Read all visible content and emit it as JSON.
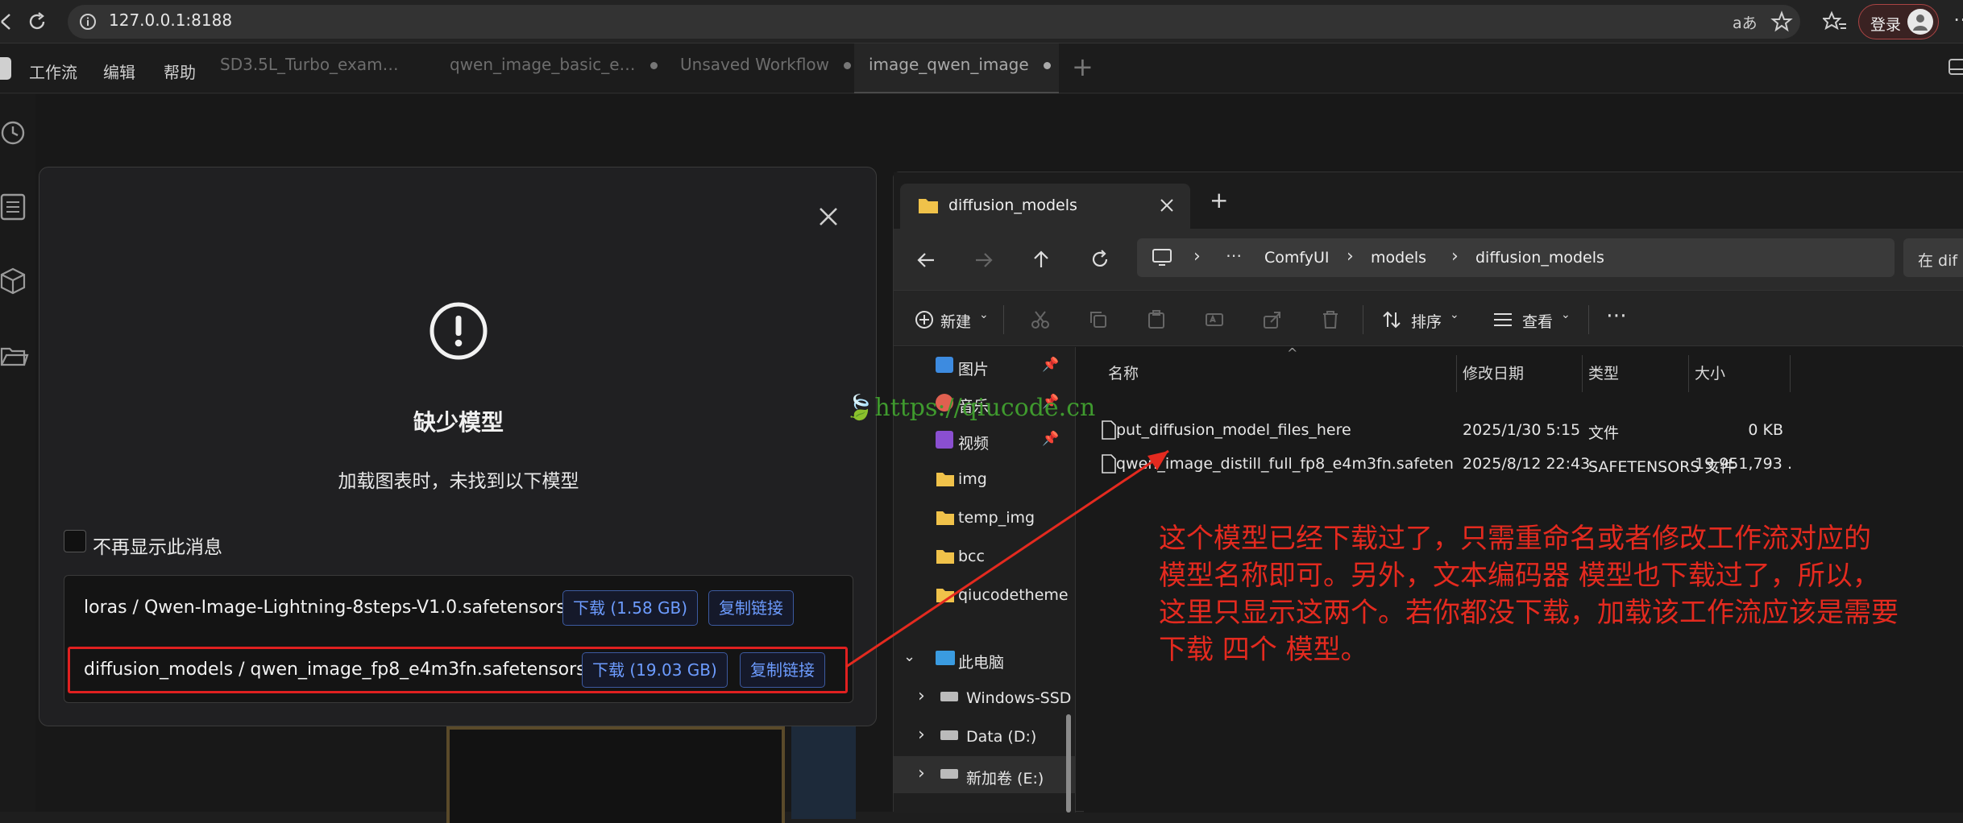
{
  "browser": {
    "url": "127.0.0.1:8188",
    "translate_glyph": "aあ",
    "login_label": "登录"
  },
  "comfy": {
    "menus": [
      "工作流",
      "编辑",
      "帮助"
    ],
    "tabs": [
      {
        "label": "SD3.5L_Turbo_exam…",
        "dot": false
      },
      {
        "label": "qwen_image_basic_e…",
        "dot": true
      },
      {
        "label": "Unsaved Workflow",
        "dot": true
      },
      {
        "label": "image_qwen_image",
        "dot": true
      }
    ],
    "sidebar_icons": [
      "history-icon",
      "document-icon",
      "cube-icon",
      "folder-icon"
    ]
  },
  "dialog": {
    "title": "缺少模型",
    "subtitle": "加载图表时，未找到以下模型",
    "checkbox_label": "不再显示此消息",
    "models": [
      {
        "name": "loras / Qwen-Image-Lightning-8steps-V1.0.safetensors",
        "download_label": "下载 (1.58 GB)",
        "copy_label": "复制链接"
      },
      {
        "name": "diffusion_models / qwen_image_fp8_e4m3fn.safetensors",
        "download_label": "下载 (19.03 GB)",
        "copy_label": "复制链接"
      }
    ]
  },
  "explorer": {
    "tab_title": "diffusion_models",
    "breadcrumb": [
      "ComfyUI",
      "models",
      "diffusion_models"
    ],
    "search_placeholder": "在 dif",
    "toolbar": {
      "new_label": "新建",
      "sort_label": "排序",
      "view_label": "查看"
    },
    "nav_items": [
      {
        "label": "图片",
        "icon": "pictures-icon",
        "pinned": true
      },
      {
        "label": "音乐",
        "icon": "music-icon",
        "pinned": true
      },
      {
        "label": "视频",
        "icon": "video-icon",
        "pinned": true
      },
      {
        "label": "img",
        "icon": "folder-icon",
        "pinned": false
      },
      {
        "label": "temp_img",
        "icon": "folder-icon",
        "pinned": false
      },
      {
        "label": "bcc",
        "icon": "folder-icon",
        "pinned": false
      },
      {
        "label": "qiucodetheme",
        "icon": "folder-icon",
        "pinned": false
      },
      {
        "label": "此电脑",
        "icon": "computer-icon",
        "pinned": false
      },
      {
        "label": "Windows-SSD",
        "icon": "drive-icon",
        "pinned": false
      },
      {
        "label": "Data (D:)",
        "icon": "drive-icon",
        "pinned": false
      },
      {
        "label": "新加卷 (E:)",
        "icon": "drive-icon",
        "pinned": false
      }
    ],
    "columns": [
      "名称",
      "修改日期",
      "类型",
      "大小"
    ],
    "files": [
      {
        "name": "put_diffusion_model_files_here",
        "date": "2025/1/30 5:15",
        "type": "文件",
        "size": "0 KB"
      },
      {
        "name": "qwen_image_distill_full_fp8_e4m3fn.safeten…",
        "date": "2025/8/12 22:43",
        "type": "SAFETENSORS 文件",
        "size": "19,951,793 …"
      }
    ]
  },
  "annotation": {
    "lines": [
      "这个模型已经下载过了，只需重命名或者修改工作流对应的",
      "模型名称即可。另外，文本编码器 模型也下载过了，所以，",
      "这里只显示这两个。若你都没下载，加载该工作流应该是需要",
      "下载 四个 模型。"
    ],
    "color": "#e42a1f"
  },
  "watermark": {
    "text": "https://qiucode.cn",
    "color": "#3f9a2e"
  }
}
